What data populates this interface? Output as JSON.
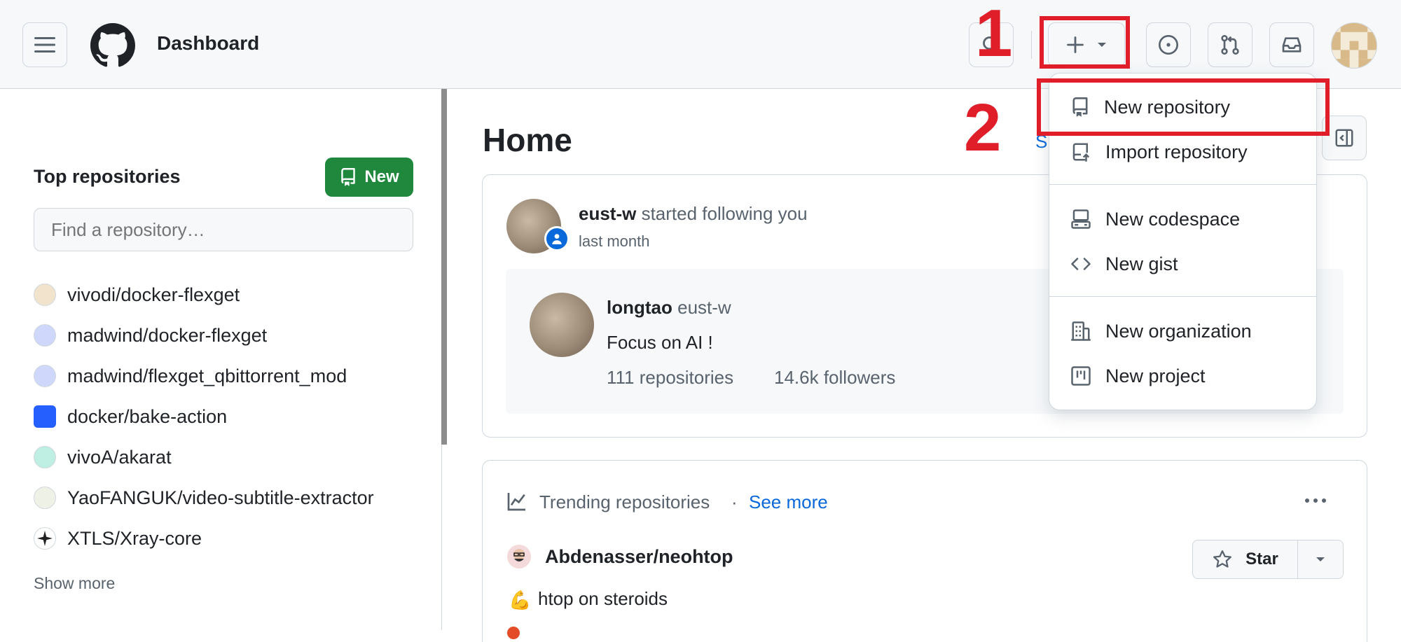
{
  "header": {
    "title": "Dashboard"
  },
  "sidebar": {
    "heading": "Top repositories",
    "new_button": "New",
    "search_placeholder": "Find a repository…",
    "repos": [
      {
        "name": "vivodi/docker-flexget",
        "color": "#e8c9a0"
      },
      {
        "name": "madwind/docker-flexget",
        "color": "#a9b8f0"
      },
      {
        "name": "madwind/flexget_qbittorrent_mod",
        "color": "#a9b8f0"
      },
      {
        "name": "docker/bake-action",
        "color": "#2560ff"
      },
      {
        "name": "vivoA/akarat",
        "color": "#7fd8c0"
      },
      {
        "name": "YaoFANGUK/video-subtitle-extractor",
        "color": "#d8e0c8"
      },
      {
        "name": "XTLS/Xray-core",
        "color": "#222222"
      }
    ],
    "show_more": "Show more"
  },
  "main": {
    "title": "Home",
    "title_side_fragment": "S",
    "follow": {
      "user": "eust-w",
      "action": "started following you",
      "time": "last month",
      "profile_name": "longtao",
      "profile_login": "eust-w",
      "bio": "Focus on AI !",
      "repositories": "111 repositories",
      "followers": "14.6k followers"
    },
    "trending": {
      "label": "Trending repositories",
      "separator": "·",
      "see_more": "See more",
      "more_menu": "...",
      "repo": "Abdenasser/neohtop",
      "description": "htop on steroids",
      "star_label": "Star"
    }
  },
  "create_menu": {
    "items": [
      {
        "label": "New repository",
        "icon": "repo-icon"
      },
      {
        "label": "Import repository",
        "icon": "repo-push-icon"
      },
      {
        "label": "New codespace",
        "icon": "codespaces-icon"
      },
      {
        "label": "New gist",
        "icon": "code-icon"
      },
      {
        "label": "New organization",
        "icon": "organization-icon"
      },
      {
        "label": "New project",
        "icon": "project-icon"
      }
    ]
  },
  "annotations": {
    "step1": "1",
    "step2": "2",
    "color": "#e01e2a"
  }
}
